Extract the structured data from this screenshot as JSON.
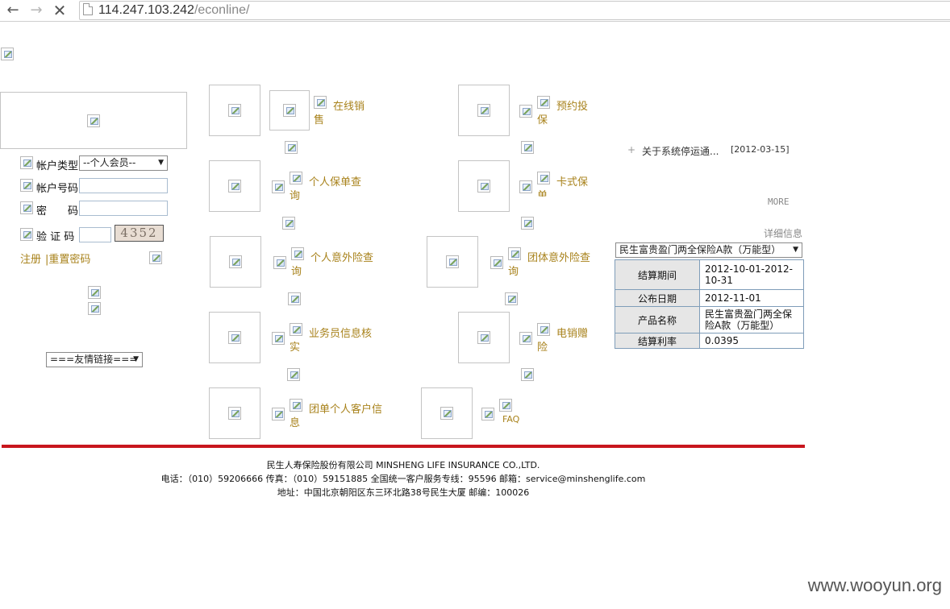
{
  "browser": {
    "url_host": "114.247.103.242",
    "url_path": "/econline/",
    "back_icon": "arrow-left-icon",
    "forward_icon": "arrow-right-icon",
    "stop_icon": "close-icon"
  },
  "login": {
    "account_type_label": "帐户类型",
    "account_type_value": "--个人会员--",
    "account_no_label": "帐户号码",
    "password_label": "密　　码",
    "captcha_label": "验 证 码",
    "captcha_text": "4352",
    "register_link": "注册",
    "reset_password_link": "|重置密码",
    "friend_links_select": "===友情链接==="
  },
  "services": {
    "online_sales": "在线销售",
    "personal_policy": "个人保单查询",
    "personal_accident": "个人意外险查询",
    "agent_check": "业务员信息核实",
    "group_customer": "团单个人客户信息",
    "reservation": "预约投保",
    "card_policy": "卡式保单",
    "group_accident": "团体意外险查询",
    "telesales": "电销赠险",
    "faq": "FAQ"
  },
  "news": {
    "bullet": "+",
    "item_title": "关于系统停运通...",
    "item_date": "[2012-03-15]",
    "more": "MORE"
  },
  "product": {
    "details_link": "详细信息",
    "select_value": "民生富贵盈门两全保险A款（万能型）",
    "rows": [
      {
        "label": "结算期间",
        "value": "2012-10-01-2012-10-31"
      },
      {
        "label": "公布日期",
        "value": "2012-11-01"
      },
      {
        "label": "产品名称",
        "value": "民生富贵盈门两全保险A款（万能型）"
      },
      {
        "label": "结算利率",
        "value": "0.0395"
      }
    ]
  },
  "footer": {
    "line1": "民生人寿保险股份有限公司 MINSHENG LIFE INSURANCE CO.,LTD.",
    "line2": "电话：（010）59206666 传真：（010）59151885 全国统一客户服务专线：95596 邮箱：service@minshenglife.com",
    "line3": "地址：中国北京朝阳区东三环北路38号民生大厦 邮编：100026"
  },
  "watermark": "www.wooyun.org",
  "colors": {
    "link": "#a8821b",
    "accent_red": "#c8161d"
  }
}
